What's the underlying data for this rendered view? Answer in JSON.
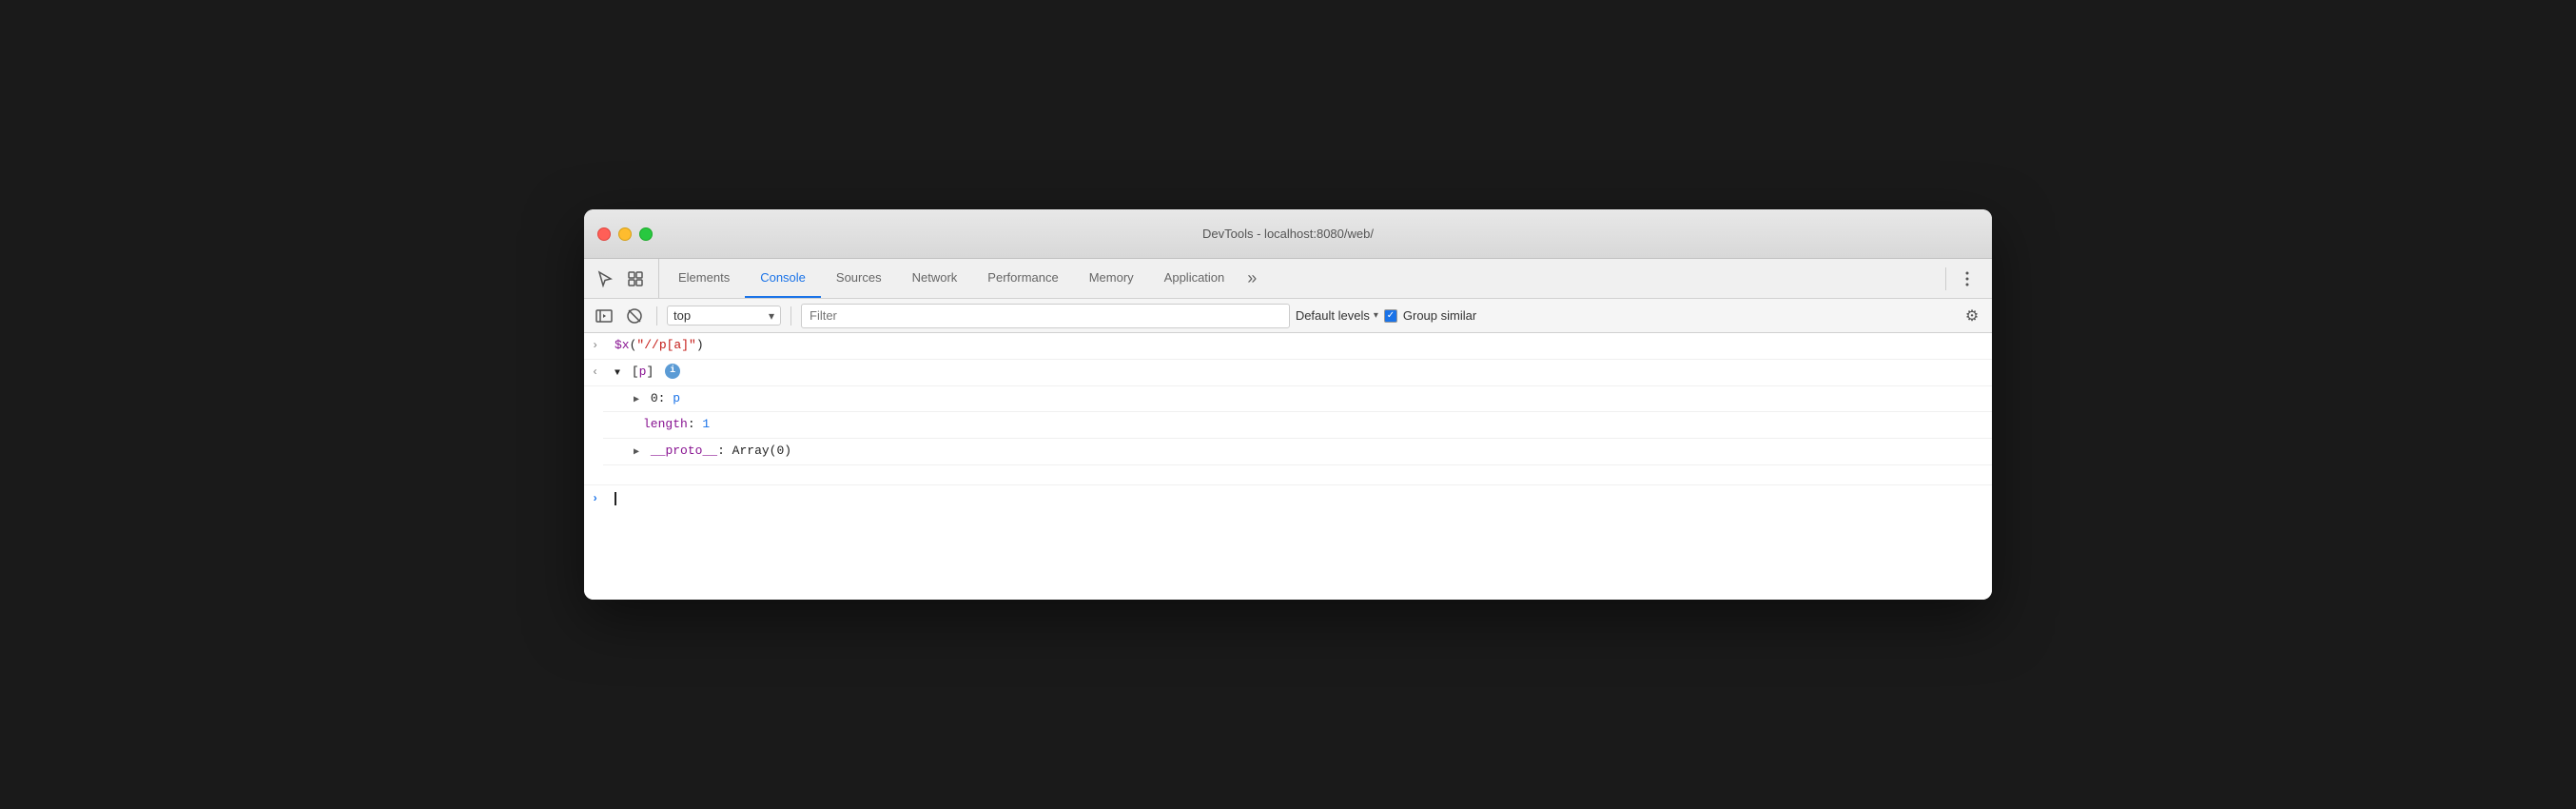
{
  "window": {
    "title": "DevTools - localhost:8080/web/"
  },
  "tabs": [
    {
      "id": "elements",
      "label": "Elements",
      "active": false
    },
    {
      "id": "console",
      "label": "Console",
      "active": true
    },
    {
      "id": "sources",
      "label": "Sources",
      "active": false
    },
    {
      "id": "network",
      "label": "Network",
      "active": false
    },
    {
      "id": "performance",
      "label": "Performance",
      "active": false
    },
    {
      "id": "memory",
      "label": "Memory",
      "active": false
    },
    {
      "id": "application",
      "label": "Application",
      "active": false
    }
  ],
  "toolbar": {
    "context": "top",
    "filter_placeholder": "Filter",
    "levels_label": "Default levels",
    "group_similar_label": "Group similar",
    "group_similar_checked": true
  },
  "console": {
    "lines": [
      {
        "prefix": ">",
        "content": "$x(\"//p[a]\")",
        "type": "input"
      },
      {
        "prefix": "<",
        "content": "▼ [p]",
        "type": "output-array"
      },
      {
        "prefix": "",
        "content": "▶ 0: p",
        "type": "item-collapsed",
        "indent": 1
      },
      {
        "prefix": "",
        "content": "length: 1",
        "type": "property",
        "indent": 1
      },
      {
        "prefix": "",
        "content": "▶ __proto__: Array(0)",
        "type": "item-collapsed",
        "indent": 1
      }
    ],
    "cursor_line_prefix": ">",
    "cursor_text": ""
  },
  "icons": {
    "cursor": "↖",
    "layers": "⧉",
    "more_tabs": "»",
    "three_dots": "⋮",
    "sidebar_toggle": "▶|",
    "clear_console": "🚫",
    "chevron_down": "▾",
    "checkmark": "✓",
    "gear": "⚙",
    "info": "i"
  }
}
